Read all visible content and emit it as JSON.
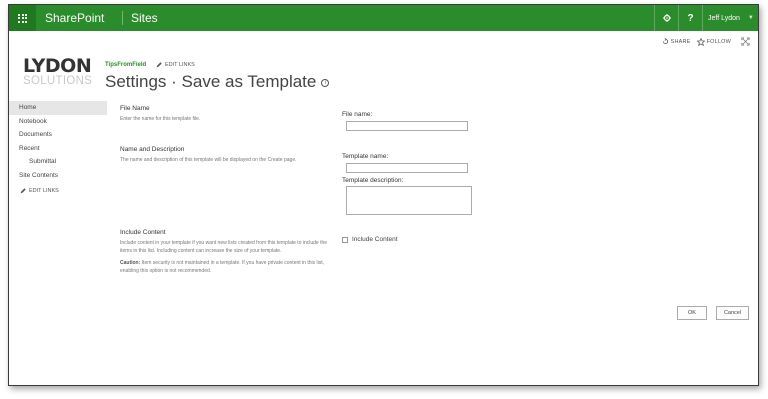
{
  "suite_bar": {
    "brand": "SharePoint",
    "sites": "Sites",
    "help_glyph": "?",
    "user_name": "Jeff Lydon",
    "icons": [
      "app-launcher-icon",
      "gear-icon",
      "help-icon",
      "chevron-down-icon"
    ],
    "colors": {
      "bar": "#2a8c2a",
      "launcher": "#1f7a1f"
    }
  },
  "actions": {
    "share_label": "SHARE",
    "follow_label": "FOLLOW",
    "icons": [
      "share-icon",
      "star-icon",
      "focus-icon"
    ]
  },
  "logo": {
    "top": "LYDON",
    "bottom": "SOLUTIONS"
  },
  "header": {
    "site_link": "TipsFromField",
    "edit_links": "EDIT LINKS",
    "title": "Settings · Save as Template"
  },
  "left_nav": {
    "items": [
      {
        "label": "Home",
        "selected": true
      },
      {
        "label": "Notebook"
      },
      {
        "label": "Documents"
      },
      {
        "label": "Recent"
      },
      {
        "label": "Submittal",
        "sub": true
      },
      {
        "label": "Site Contents"
      }
    ],
    "edit_links": "EDIT LINKS"
  },
  "form": {
    "file_name_section": {
      "title": "File Name",
      "description": "Enter the name for this template file.",
      "field_label": "File name:",
      "value": ""
    },
    "name_description_section": {
      "title": "Name and Description",
      "description": "The name and description of this template will be displayed on the Create page.",
      "name_label": "Template name:",
      "name_value": "",
      "description_label": "Template description:",
      "description_value": ""
    },
    "include_content_section": {
      "title": "Include Content",
      "description": "Include content in your template if you want new lists created from this template to include the items in this list. Including content can increase the size of your template.",
      "caution_label": "Caution:",
      "caution_text": "Item security is not maintained in a template. If you have private content in this list, enabling this option is not recommended.",
      "checkbox_label": "Include Content",
      "checked": false
    },
    "ok_label": "OK",
    "cancel_label": "Cancel"
  }
}
